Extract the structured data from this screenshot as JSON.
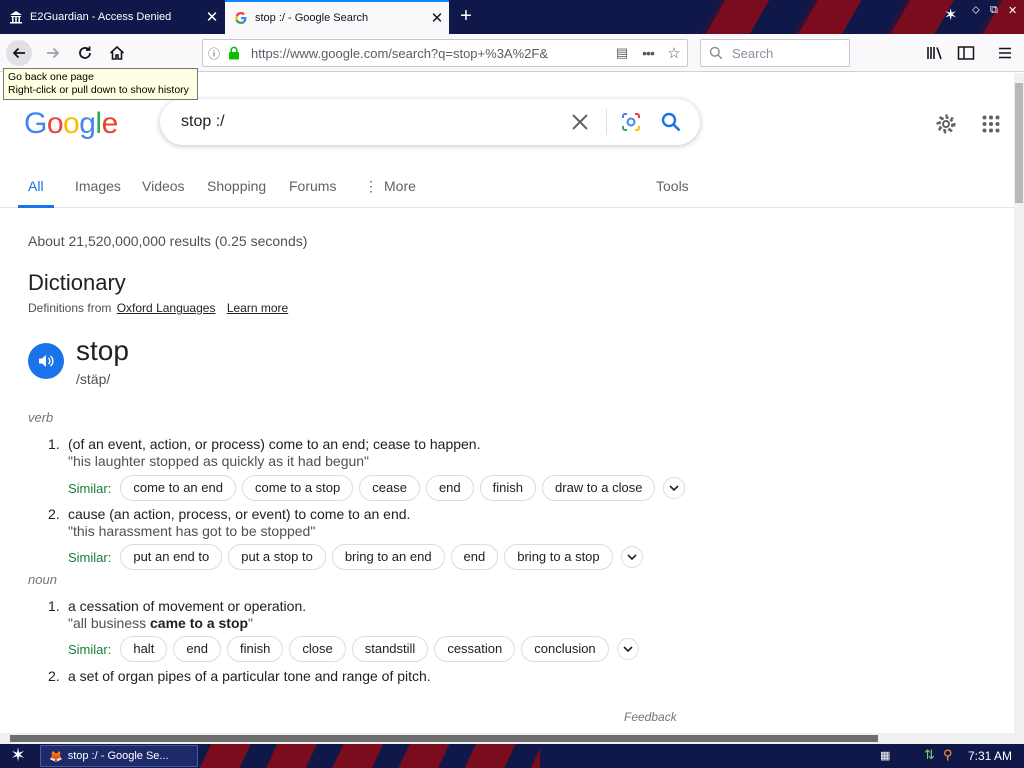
{
  "browser": {
    "tabs": [
      {
        "title": "E2Guardian - Access Denied",
        "icon": "bank-icon",
        "active": false
      },
      {
        "title": "stop :/ - Google Search",
        "icon": "google-g-icon",
        "active": true
      }
    ],
    "url": "https://www.google.com/search?q=stop+%3A%2F&",
    "search_placeholder": "Search",
    "tooltip_line1": "Go back one page",
    "tooltip_line2": "Right-click or pull down to show history"
  },
  "google": {
    "logo": "Google",
    "query": "stop :/",
    "tabs": [
      "All",
      "Images",
      "Videos",
      "Shopping",
      "Forums",
      "More"
    ],
    "tools": "Tools",
    "results_stats": "About 21,520,000,000 results (0.25 seconds)",
    "dictionary_title": "Dictionary",
    "definitions_from": "Definitions from",
    "oxford": "Oxford Languages",
    "learn_more": "Learn more",
    "word": "stop",
    "phonetic": "/stäp/",
    "similar_label": "Similar:",
    "feedback": "Feedback",
    "senses": [
      {
        "pos": "verb"
      },
      {
        "n": "1.",
        "def": "(of an event, action, or process) come to an end; cease to happen.",
        "example": "\"his laughter stopped as quickly as it had begun\"",
        "similar": [
          "come to an end",
          "come to a stop",
          "cease",
          "end",
          "finish",
          "draw to a close"
        ]
      },
      {
        "n": "2.",
        "def": "cause (an action, process, or event) to come to an end.",
        "example": "\"this harassment has got to be stopped\"",
        "similar": [
          "put an end to",
          "put a stop to",
          "bring to an end",
          "end",
          "bring to a stop"
        ]
      },
      {
        "pos": "noun"
      },
      {
        "n": "1.",
        "def": "a cessation of movement or operation.",
        "example_pre": "\"all business ",
        "example_bold": "came to a stop",
        "example_post": "\"",
        "similar": [
          "halt",
          "end",
          "finish",
          "close",
          "standstill",
          "cessation",
          "conclusion"
        ]
      },
      {
        "n": "2.",
        "def": "a set of organ pipes of a particular tone and range of pitch."
      }
    ]
  },
  "taskbar": {
    "task_title": "stop :/ - Google Se...",
    "clock": "7:31 AM"
  },
  "colors": {
    "accent": "#1a73e8",
    "similar": "#188038",
    "firefox_blue": "#0a84ff"
  }
}
